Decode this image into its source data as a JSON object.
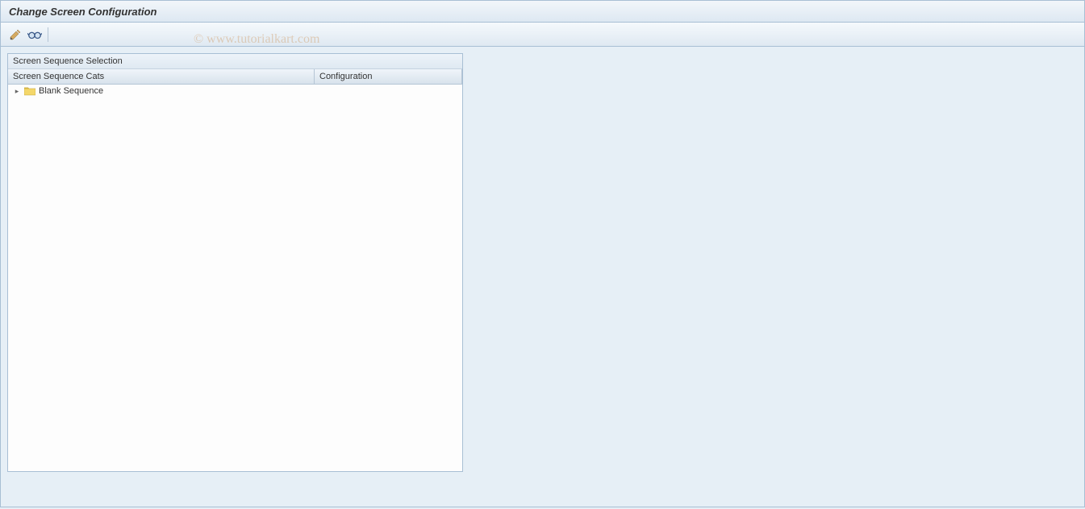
{
  "title": "Change Screen Configuration",
  "watermark": "© www.tutorialkart.com",
  "panel": {
    "title": "Screen Sequence Selection",
    "columns": {
      "col1": "Screen Sequence Cats",
      "col2": "Configuration"
    },
    "tree": {
      "item1": {
        "label": "Blank Sequence"
      }
    }
  }
}
